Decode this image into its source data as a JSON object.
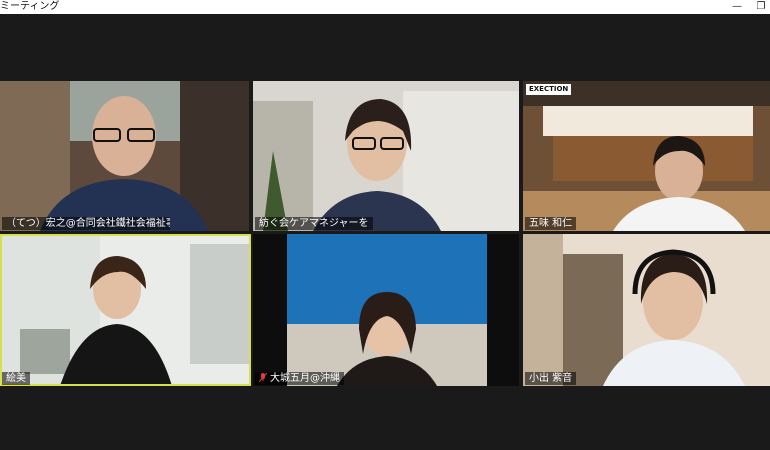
{
  "window": {
    "title": "ミーティング",
    "minimize_glyph": "—",
    "restore_glyph": "❐"
  },
  "participants": [
    {
      "name": "（てつ）宏之@合同会社鐵社会福祉事...",
      "active_speaker": false,
      "muted": false
    },
    {
      "name": "紡ぐ会ケアマネジャーを",
      "active_speaker": false,
      "muted": false
    },
    {
      "name": "五味 和仁",
      "active_speaker": false,
      "muted": false,
      "background_sign": "EXECTION"
    },
    {
      "name": "絵美",
      "active_speaker": true,
      "muted": false
    },
    {
      "name": "大城五月@沖縄",
      "active_speaker": false,
      "muted": true
    },
    {
      "name": "小出 紫音",
      "active_speaker": false,
      "muted": false
    }
  ],
  "colors": {
    "active_speaker_border": "#d7e04a",
    "muted_icon": "#e23b3b"
  }
}
